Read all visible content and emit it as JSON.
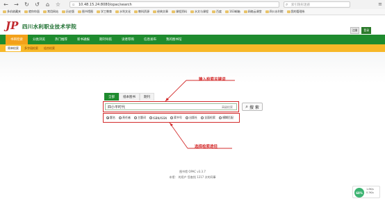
{
  "browser": {
    "url": "10.48.15.24:8080/opac/search",
    "search_placeholder": "索引隐形迷惑",
    "back": "←",
    "forward": "→",
    "refresh": "↻",
    "undo": "↺",
    "home": "⌂",
    "star": "☆"
  },
  "bookmarks": [
    {
      "label": "多机收藏夹"
    },
    {
      "label": "就你你面"
    },
    {
      "label": "常用网站"
    },
    {
      "label": "历史版"
    },
    {
      "label": "图书馆图"
    },
    {
      "label": "学工教育"
    },
    {
      "label": "水利文化"
    },
    {
      "label": "教科资源"
    },
    {
      "label": "经典文章"
    },
    {
      "label": "课程资料"
    },
    {
      "label": "水文与课程"
    },
    {
      "label": "百度"
    },
    {
      "label": "163邮箱"
    },
    {
      "label": "网络云课堂"
    },
    {
      "label": "四川水利院"
    },
    {
      "label": "我的管理系"
    }
  ],
  "header": {
    "logo": "JP",
    "title": "四川水利职业技术学院",
    "btn_register": "注册",
    "btn_login": "登录"
  },
  "nav": [
    {
      "label": "书目检索"
    },
    {
      "label": "分类浏览"
    },
    {
      "label": "热门推荐"
    },
    {
      "label": "新书通报"
    },
    {
      "label": "期刊导航"
    },
    {
      "label": "读者荐购"
    },
    {
      "label": "信息发布"
    },
    {
      "label": "我的图书馆"
    }
  ],
  "subnav": [
    {
      "label": "简单检索"
    },
    {
      "label": "多字段检索"
    },
    {
      "label": "组合检索"
    }
  ],
  "search": {
    "tabs": [
      {
        "label": "全部"
      },
      {
        "label": "纸本图书"
      },
      {
        "label": "期刊"
      }
    ],
    "input_value": "四小平时代",
    "advanced_link": "高级检索",
    "button_label": "搜 索",
    "options": [
      {
        "label": "题名"
      },
      {
        "label": "责任者"
      },
      {
        "label": "主题词"
      },
      {
        "label": "ISBN/ISSN"
      },
      {
        "label": "索书号"
      },
      {
        "label": "出版社"
      },
      {
        "label": "全面检索"
      },
      {
        "label": "模糊匹配"
      }
    ]
  },
  "annotations": {
    "keyword": "输入检索关键词",
    "field": "选择检索途径"
  },
  "footer": {
    "line1": "图书馆  OPAC v3.3.7",
    "line2": "本馆：  的用户 您查找 1217 次的同事"
  },
  "widget": {
    "percent": "68%",
    "up": "1.8K/s",
    "down": "0.3K/s"
  },
  "colors": {
    "nav_green": "#1e8b2e",
    "nav_active_orange": "#f3a11a",
    "subnav_yellow": "#f7b828",
    "annotation_red": "#d32b2b",
    "logo_red": "#c0282d"
  }
}
